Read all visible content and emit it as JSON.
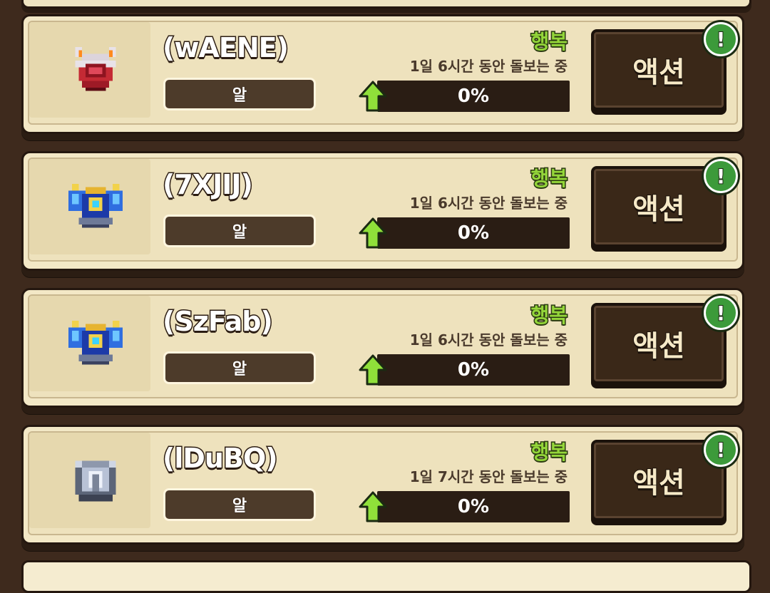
{
  "colors": {
    "background": "#3e2a1d",
    "card": "#f3e8c6",
    "mood_green": "#94d63a",
    "alert_green": "#3c9a3a",
    "button_brown": "#3a2818"
  },
  "pets": [
    {
      "name": "(wAENE)",
      "stage": "알",
      "mood": "행복",
      "care_time": "1일 6시간 동안 돌보는 중",
      "progress_label": "0%",
      "progress": 0,
      "action_label": "액션",
      "alert": "!",
      "icon": "red-egg-icon"
    },
    {
      "name": "(7XJIJ)",
      "stage": "알",
      "mood": "행복",
      "care_time": "1일 6시간 동안 돌보는 중",
      "progress_label": "0%",
      "progress": 0,
      "action_label": "액션",
      "alert": "!",
      "icon": "blue-winged-egg-icon"
    },
    {
      "name": "(SzFab)",
      "stage": "알",
      "mood": "행복",
      "care_time": "1일 6시간 동안 돌보는 중",
      "progress_label": "0%",
      "progress": 0,
      "action_label": "액션",
      "alert": "!",
      "icon": "blue-winged-egg-icon"
    },
    {
      "name": "(lDuBQ)",
      "stage": "알",
      "mood": "행복",
      "care_time": "1일 7시간 동안 돌보는 중",
      "progress_label": "0%",
      "progress": 0,
      "action_label": "액션",
      "alert": "!",
      "icon": "silver-egg-icon"
    }
  ]
}
